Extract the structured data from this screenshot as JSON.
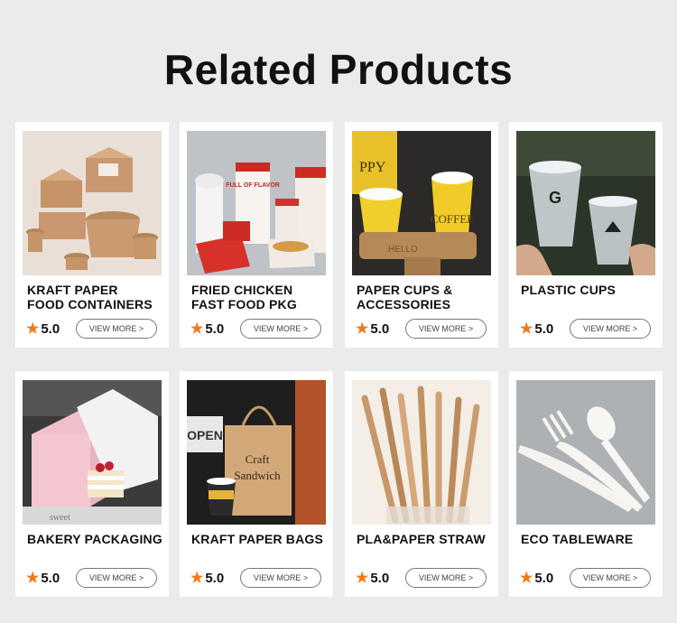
{
  "page": {
    "title": "Related Products"
  },
  "products": [
    {
      "name_line1": "KRAFT PAPER",
      "name_line2": "FOOD CONTAINERS",
      "rating": "5.0",
      "button": "VIEW MORE >"
    },
    {
      "name_line1": "FRIED CHICKEN",
      "name_line2": "FAST FOOD PKG",
      "rating": "5.0",
      "button": "VIEW MORE >"
    },
    {
      "name_line1": "PAPER CUPS &",
      "name_line2": "ACCESSORIES",
      "rating": "5.0",
      "button": "VIEW MORE >"
    },
    {
      "name_line1": "PLASTIC CUPS",
      "name_line2": "",
      "rating": "5.0",
      "button": "VIEW MORE >"
    },
    {
      "name_line1": "BAKERY PACKAGING",
      "name_line2": "",
      "rating": "5.0",
      "button": "VIEW MORE >"
    },
    {
      "name_line1": "KRAFT PAPER BAGS",
      "name_line2": "",
      "rating": "5.0",
      "button": "VIEW MORE >"
    },
    {
      "name_line1": "PLA&PAPER STRAW",
      "name_line2": "",
      "rating": "5.0",
      "button": "VIEW MORE >"
    },
    {
      "name_line1": "ECO TABLEWARE",
      "name_line2": "",
      "rating": "5.0",
      "button": "VIEW MORE >"
    }
  ],
  "image_text": {
    "fried_chicken_box": "FULL OF FLAVOR",
    "cup_text": "COFFEE",
    "cup_top_text": "PPY",
    "sleeve_text": "HELLO",
    "plastic_cup_logo": "G",
    "bag_text_1": "Craft",
    "bag_text_2": "Sandwich",
    "window_sign": "OPEN",
    "bakery_sleeve": "sweet"
  },
  "icons": {
    "rating": "star-icon"
  },
  "colors": {
    "star": "#f07a1a",
    "background": "#ebebeb",
    "card": "#ffffff"
  }
}
